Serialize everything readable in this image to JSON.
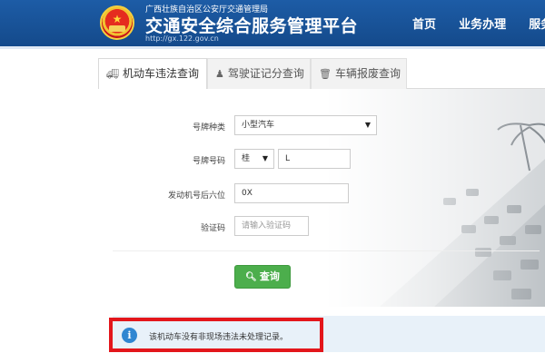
{
  "header": {
    "subtitle": "广西壮族自治区公安厅交通管理局",
    "title": "交通安全综合服务管理平台",
    "url": "http://gx.122.gov.cn",
    "nav": [
      "首页",
      "业务办理",
      "服务"
    ]
  },
  "tabs": [
    {
      "label": "机动车违法查询",
      "icon": "truck-icon",
      "active": true
    },
    {
      "label": "驾驶证记分查询",
      "icon": "person-icon",
      "active": false
    },
    {
      "label": "车辆报废查询",
      "icon": "trash-icon",
      "active": false
    }
  ],
  "form": {
    "plate_type": {
      "label": "号牌种类",
      "value": "小型汽车"
    },
    "plate_number": {
      "label": "号牌号码",
      "prefix": "桂",
      "value": "L"
    },
    "engine": {
      "label": "发动机号后六位",
      "value": "0X"
    },
    "captcha": {
      "label": "验证码",
      "placeholder": "请输入验证码"
    },
    "submit_label": "查询"
  },
  "result": {
    "message": "该机动车没有非现场违法未处理记录。",
    "icon": "info-icon"
  },
  "colors": {
    "header_bg": "#1a569d",
    "button_green": "#4cae4c",
    "highlight_red": "#e3161b",
    "info_blue": "#2f86d1"
  }
}
